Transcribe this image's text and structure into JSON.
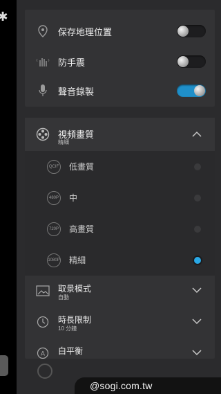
{
  "top_panel": {
    "items": [
      {
        "label": "保存地理位置",
        "icon": "location-pin-icon",
        "enabled": false
      },
      {
        "label": "防手震",
        "icon": "hand-stabilize-icon",
        "enabled": false
      },
      {
        "label": "聲音錄製",
        "icon": "microphone-icon",
        "enabled": true
      }
    ]
  },
  "video_quality": {
    "title": "視頻畫質",
    "value": "精細",
    "options": [
      {
        "badge": "QCIF",
        "label": "低畫質",
        "selected": false
      },
      {
        "badge": "480P",
        "label": "中",
        "selected": false
      },
      {
        "badge": "720P",
        "label": "高畫質",
        "selected": false
      },
      {
        "badge": "1080P",
        "label": "精細",
        "selected": true
      }
    ]
  },
  "scene_mode": {
    "title": "取景模式",
    "value": "自動"
  },
  "time_limit": {
    "title": "時長限制",
    "value": "10 分鐘"
  },
  "white_balance": {
    "title": "白平衡"
  },
  "footer": {
    "credit": "@sogi.com.tw"
  },
  "colors": {
    "accent": "#29a8e6",
    "toggle_on": "#1f8fc9",
    "panel": "#333335"
  }
}
